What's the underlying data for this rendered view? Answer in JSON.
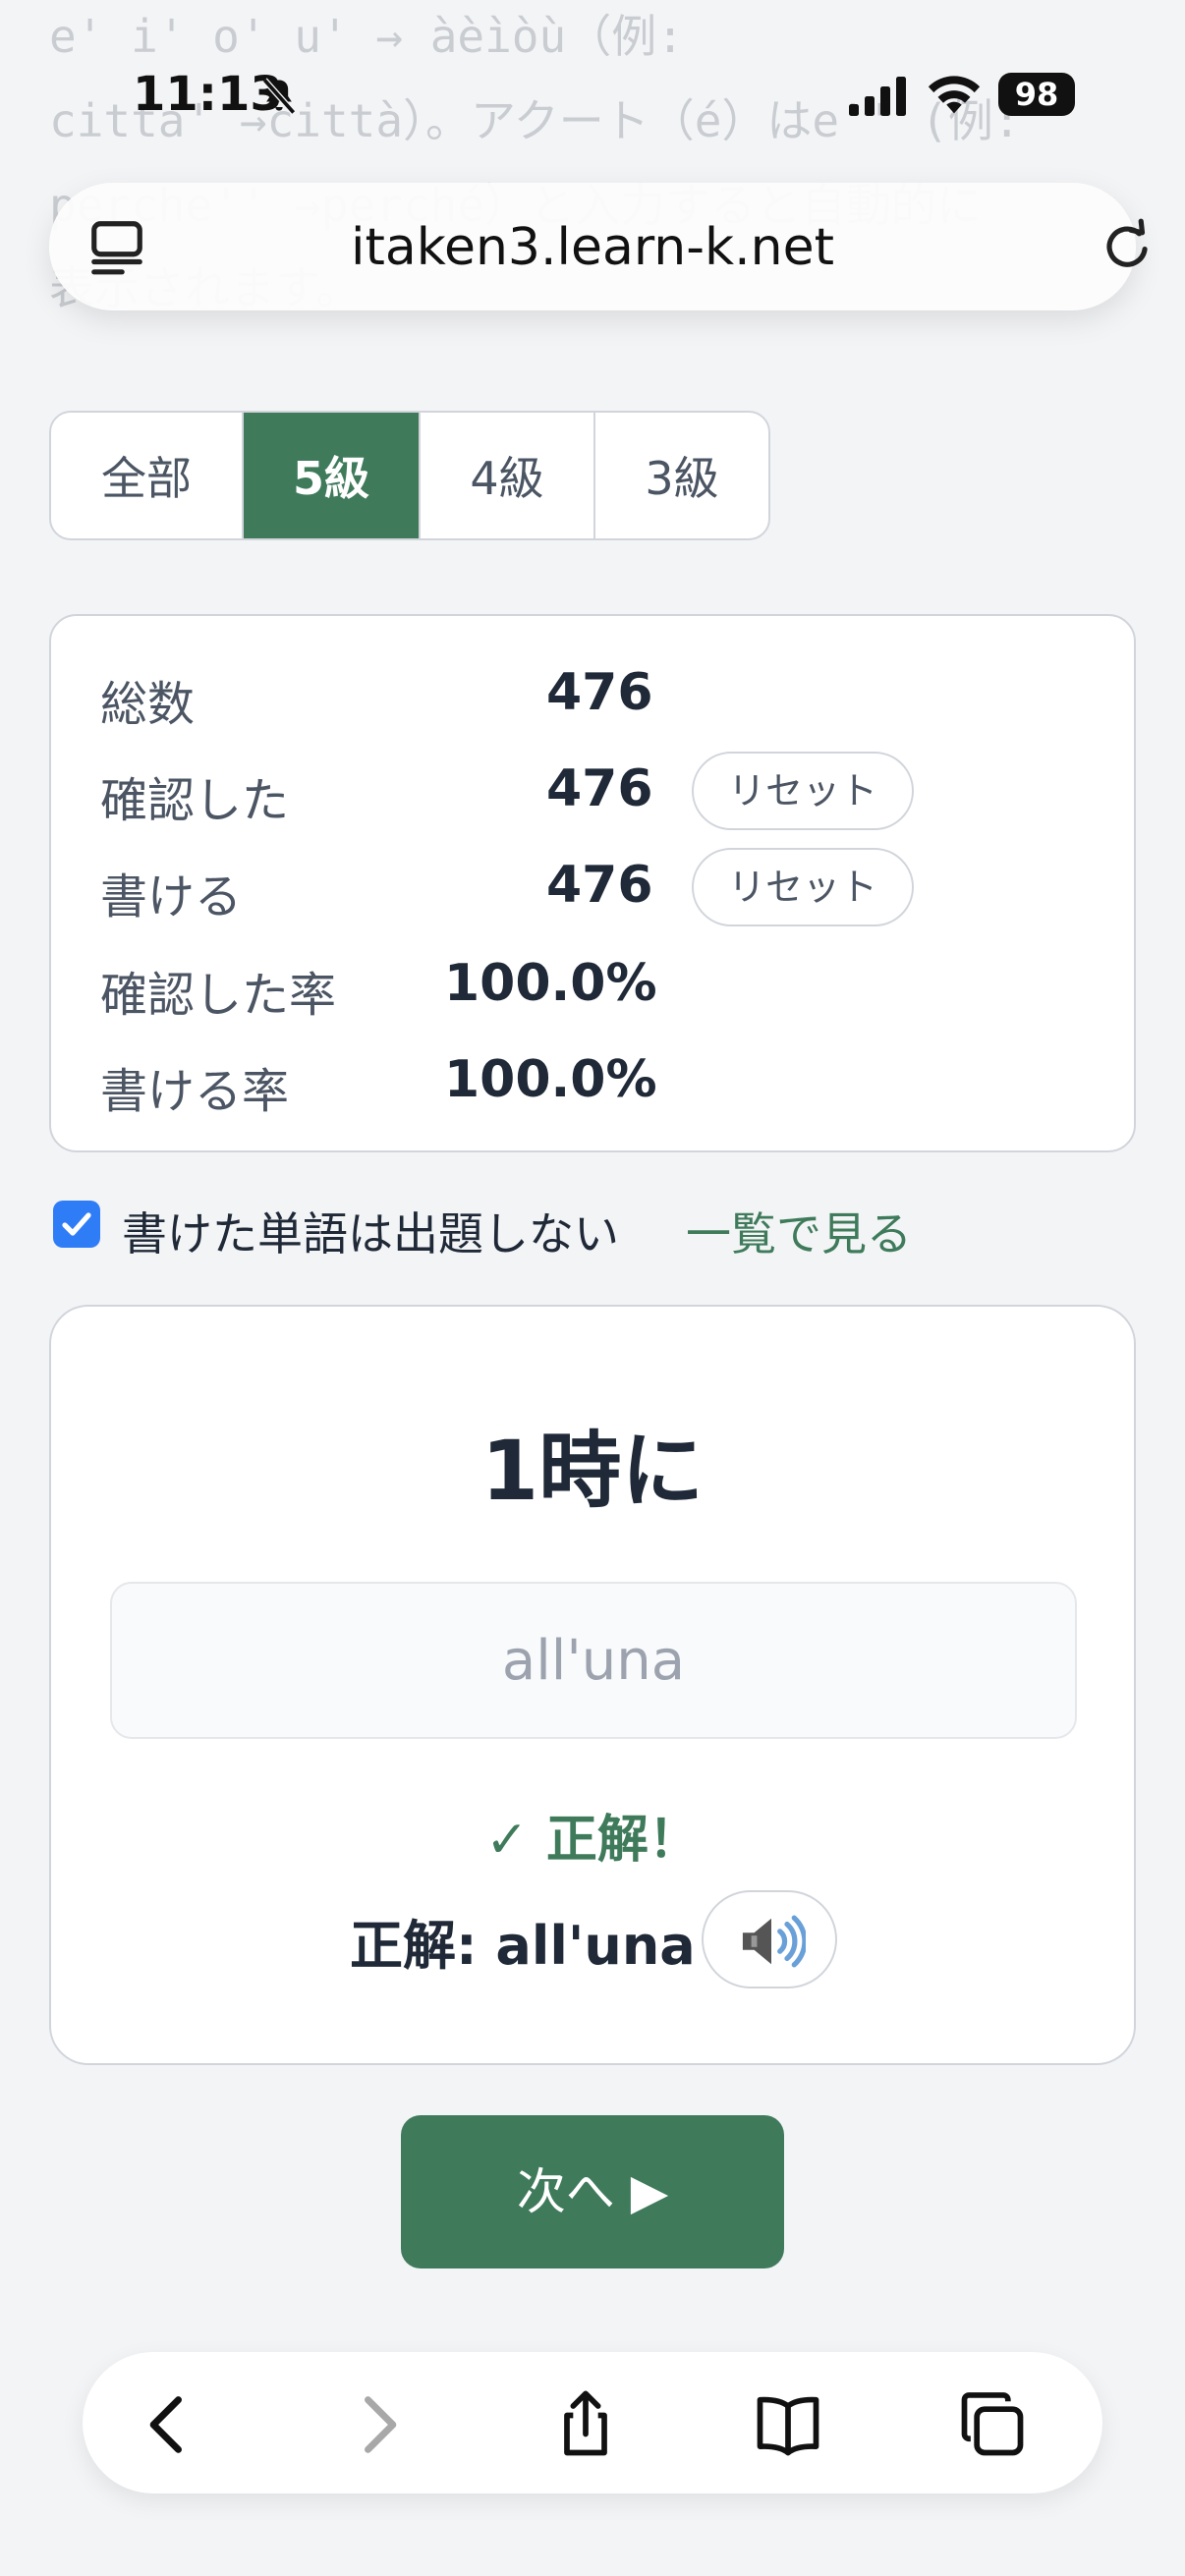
{
  "background_text": {
    "line1": "e' i' o' u' → àèìòù（例:",
    "line2": "citta' →città）。アクート（é）はe'' (例:",
    "line3": "perche'' →perché）と入力すると自動的に",
    "line4": "表示されます。"
  },
  "status_bar": {
    "time": "11:13",
    "battery": "98"
  },
  "browser": {
    "url": "itaken3.learn-k.net"
  },
  "tabs": [
    {
      "label": "全部",
      "active": false
    },
    {
      "label": "5級",
      "active": true
    },
    {
      "label": "4級",
      "active": false
    },
    {
      "label": "3級",
      "active": false
    }
  ],
  "stats": {
    "total_label": "総数",
    "total_value": "476",
    "checked_label": "確認した",
    "checked_value": "476",
    "writable_label": "書ける",
    "writable_value": "476",
    "checked_rate_label": "確認した率",
    "checked_rate_value": "100.0%",
    "writable_rate_label": "書ける率",
    "writable_rate_value": "100.0%",
    "reset_label": "リセット"
  },
  "options": {
    "skip_written_label": "書けた単語は出題しない",
    "skip_written_checked": true,
    "list_link": "一覧で見る"
  },
  "quiz": {
    "prompt": "1時に",
    "input_value": "all'una",
    "result": "✓ 正解！",
    "correct_answer": "正解: all'una"
  },
  "next_button": "次へ ▶",
  "colors": {
    "accent": "#3f7b5b",
    "checkbox": "#2f7df6",
    "background": "#f3f4f6"
  }
}
